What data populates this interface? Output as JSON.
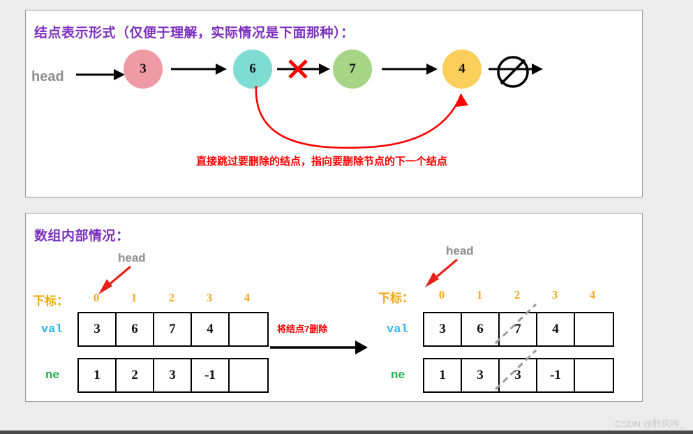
{
  "panel1": {
    "title": "结点表示形式（仅便于理解，实际情况是下面那种）：",
    "head_label": "head",
    "nodes": [
      {
        "value": "3",
        "color": "#ef9aa4"
      },
      {
        "value": "6",
        "color": "#7fdcd2"
      },
      {
        "value": "7",
        "color": "#a6d585"
      },
      {
        "value": "4",
        "color": "#f9ce5b"
      }
    ],
    "null_symbol": "Ø",
    "delete_marker": "✕",
    "red_note": "直接跳过要删除的结点，指向要删除节点的下一个结点"
  },
  "panel2": {
    "title": "数组内部情况：",
    "index_label": "下标：",
    "indices": [
      "0",
      "1",
      "2",
      "3",
      "4"
    ],
    "row_labels": {
      "val": "val",
      "ne": "ne"
    },
    "head_label": "head",
    "transition_label": "将结点7删除",
    "before": {
      "val": [
        "3",
        "6",
        "7",
        "4",
        ""
      ],
      "ne": [
        "1",
        "2",
        "3",
        "-1",
        ""
      ]
    },
    "after": {
      "val": [
        "3",
        "6",
        "7",
        "4",
        ""
      ],
      "ne": [
        "1",
        "3",
        "3",
        "-1",
        ""
      ],
      "struck_index": 2
    }
  },
  "watermark": "CSDN @聆风吟_",
  "colors": {
    "title": "#7b2fbe",
    "index": "#f7a823",
    "val_label": "#2ab5f5",
    "ne_label": "#22b14c",
    "red": "#ff0000",
    "head": "#8d8d8d"
  }
}
